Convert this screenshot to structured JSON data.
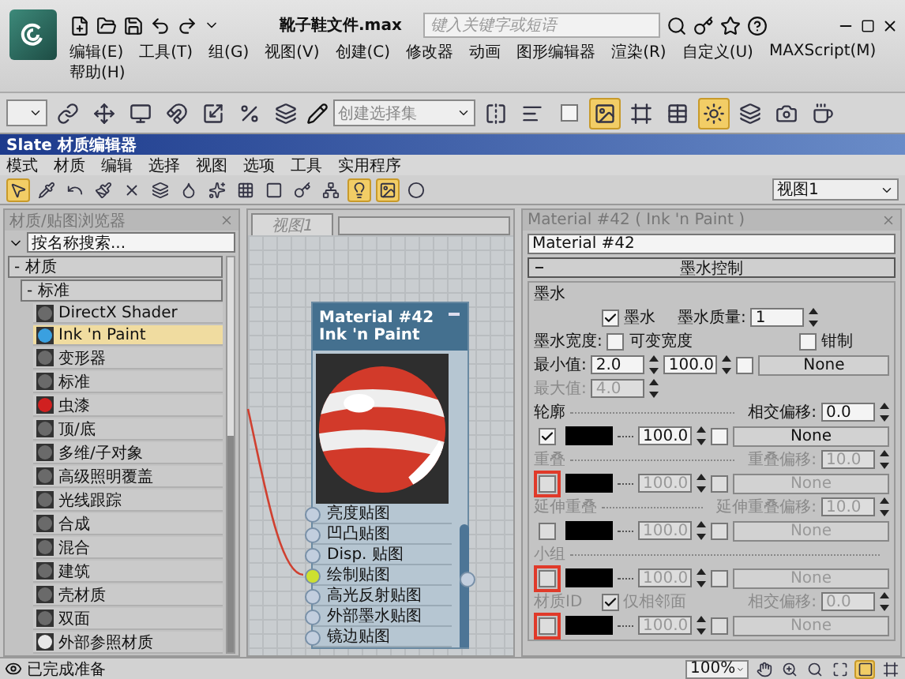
{
  "app": {
    "title": "靴子鞋文件.max",
    "search": {
      "placeholder": "键入关键字或短语"
    },
    "menu_rows": [
      [
        "编辑(E)",
        "工具(T)",
        "组(G)",
        "视图(V)",
        "创建(C)",
        "修改器",
        "动画",
        "图形编辑器",
        "渲染(R)",
        "自定义(U)",
        "MAXScript(M)"
      ],
      [
        "帮助(H)"
      ]
    ]
  },
  "main_toolbar": {
    "selection_set": {
      "placeholder": "创建选择集"
    },
    "buttons_before": [
      {
        "active": false
      },
      {
        "active": false
      },
      {
        "active": false
      },
      {
        "active": false
      },
      {
        "active": false
      },
      {
        "active": false
      },
      {
        "active": false
      }
    ],
    "buttons_after": [
      {
        "active": false
      },
      {
        "active": false
      },
      {
        "active": false
      },
      {
        "active": true
      },
      {
        "active": false
      },
      {
        "active": false
      },
      {
        "active": true
      },
      {
        "active": false
      },
      {
        "active": false
      },
      {
        "active": false
      }
    ]
  },
  "slate": {
    "title": "Slate 材质编辑器",
    "menu": [
      "模式",
      "材质",
      "编辑",
      "选择",
      "视图",
      "选项",
      "工具",
      "实用程序"
    ],
    "toolbar": [
      {
        "active": true
      },
      {
        "active": false
      },
      {
        "active": false
      },
      {
        "active": false
      },
      {
        "active": false
      },
      {
        "active": false
      },
      {
        "active": false
      },
      {
        "active": false
      },
      {
        "active": false
      },
      {
        "active": false
      },
      {
        "active": false
      },
      {
        "active": false
      },
      {
        "active": true
      },
      {
        "active": true
      },
      {
        "active": false
      }
    ],
    "view_select": "视图1"
  },
  "browser": {
    "title": "材质/贴图浏览器",
    "search": {
      "placeholder": "按名称搜索..."
    },
    "group": "- 材质",
    "subgroup": "- 标准",
    "items": [
      {
        "label": "DirectX Shader",
        "color": "#6a6a6a",
        "selected": false
      },
      {
        "label": "Ink 'n Paint",
        "color": "#3aa0e0",
        "selected": true
      },
      {
        "label": "变形器",
        "color": "#6a6a6a",
        "selected": false
      },
      {
        "label": "标准",
        "color": "#6a6a6a",
        "selected": false
      },
      {
        "label": "虫漆",
        "color": "#d02020",
        "selected": false
      },
      {
        "label": "顶/底",
        "color": "#6a6a6a",
        "selected": false
      },
      {
        "label": "多维/子对象",
        "color": "#6a6a6a",
        "selected": false
      },
      {
        "label": "高级照明覆盖",
        "color": "#6a6a6a",
        "selected": false
      },
      {
        "label": "光线跟踪",
        "color": "#6a6a6a",
        "selected": false
      },
      {
        "label": "合成",
        "color": "#6a6a6a",
        "selected": false
      },
      {
        "label": "混合",
        "color": "#6a6a6a",
        "selected": false
      },
      {
        "label": "建筑",
        "color": "#6a6a6a",
        "selected": false
      },
      {
        "label": "壳材质",
        "color": "#6a6a6a",
        "selected": false
      },
      {
        "label": "双面",
        "color": "#6a6a6a",
        "selected": false
      },
      {
        "label": "外部参照材质",
        "color": "#e8e8e8",
        "selected": false
      }
    ]
  },
  "view": {
    "tab": "视图1",
    "node": {
      "name": "Material #42",
      "type": "Ink 'n Paint",
      "slots": [
        {
          "label": "亮度贴图",
          "connected": false
        },
        {
          "label": "凹凸贴图",
          "connected": false
        },
        {
          "label": "Disp. 贴图",
          "connected": false
        },
        {
          "label": "绘制贴图",
          "connected": true
        },
        {
          "label": "高光反射贴图",
          "connected": false
        },
        {
          "label": "外部墨水贴图",
          "connected": false
        },
        {
          "label": "镜边贴图",
          "connected": false
        }
      ]
    }
  },
  "params": {
    "title": "Material #42 ( Ink 'n Paint )",
    "name": "Material #42",
    "rollout": "墨水控制",
    "group": "墨水",
    "ink": {
      "label": "墨水",
      "checked": true
    },
    "quality": {
      "label": "墨水质量:",
      "value": "1"
    },
    "width": {
      "label": "墨水宽度:",
      "variable": {
        "label": "可变宽度",
        "checked": false
      },
      "clamp": {
        "label": "钳制",
        "checked": false
      }
    },
    "min": {
      "label": "最小值:",
      "value": "2.0",
      "disabled": false
    },
    "max": {
      "label": "最大值:",
      "value": "4.0",
      "disabled": true
    },
    "width_map": {
      "amount": "100.0",
      "checked": false,
      "map": "None"
    },
    "sections": [
      {
        "label": "轮廓",
        "disabled": false,
        "checked": true,
        "highlighted": false,
        "offset": {
          "label": "相交偏移:",
          "value": "0.0"
        },
        "amount": "100.0",
        "map_checked": false,
        "map": "None"
      },
      {
        "label": "重叠",
        "disabled": true,
        "checked": false,
        "highlighted": true,
        "offset": {
          "label": "重叠偏移:",
          "value": "10.0"
        },
        "amount": "100.0",
        "map_checked": false,
        "map": "None"
      },
      {
        "label": "延伸重叠",
        "disabled": true,
        "checked": false,
        "highlighted": false,
        "offset": {
          "label": "延伸重叠偏移:",
          "value": "10.0"
        },
        "amount": "100.0",
        "map_checked": false,
        "map": "None"
      },
      {
        "label": "小组",
        "disabled": true,
        "checked": false,
        "highlighted": true,
        "amount": "100.0",
        "map_checked": false,
        "map": "None"
      },
      {
        "label": "材质ID",
        "disabled": true,
        "checked": false,
        "highlighted": true,
        "option": {
          "label": "仅相邻面",
          "checked": true
        },
        "offset": {
          "label": "相交偏移:",
          "value": "0.0"
        },
        "amount": "100.0",
        "map_checked": false,
        "map": "None"
      }
    ]
  },
  "status": {
    "text": "已完成准备",
    "zoom": "100%",
    "tools": [
      {
        "active": false
      },
      {
        "active": false
      },
      {
        "active": false
      },
      {
        "active": false
      },
      {
        "active": true
      },
      {
        "active": false
      }
    ]
  }
}
